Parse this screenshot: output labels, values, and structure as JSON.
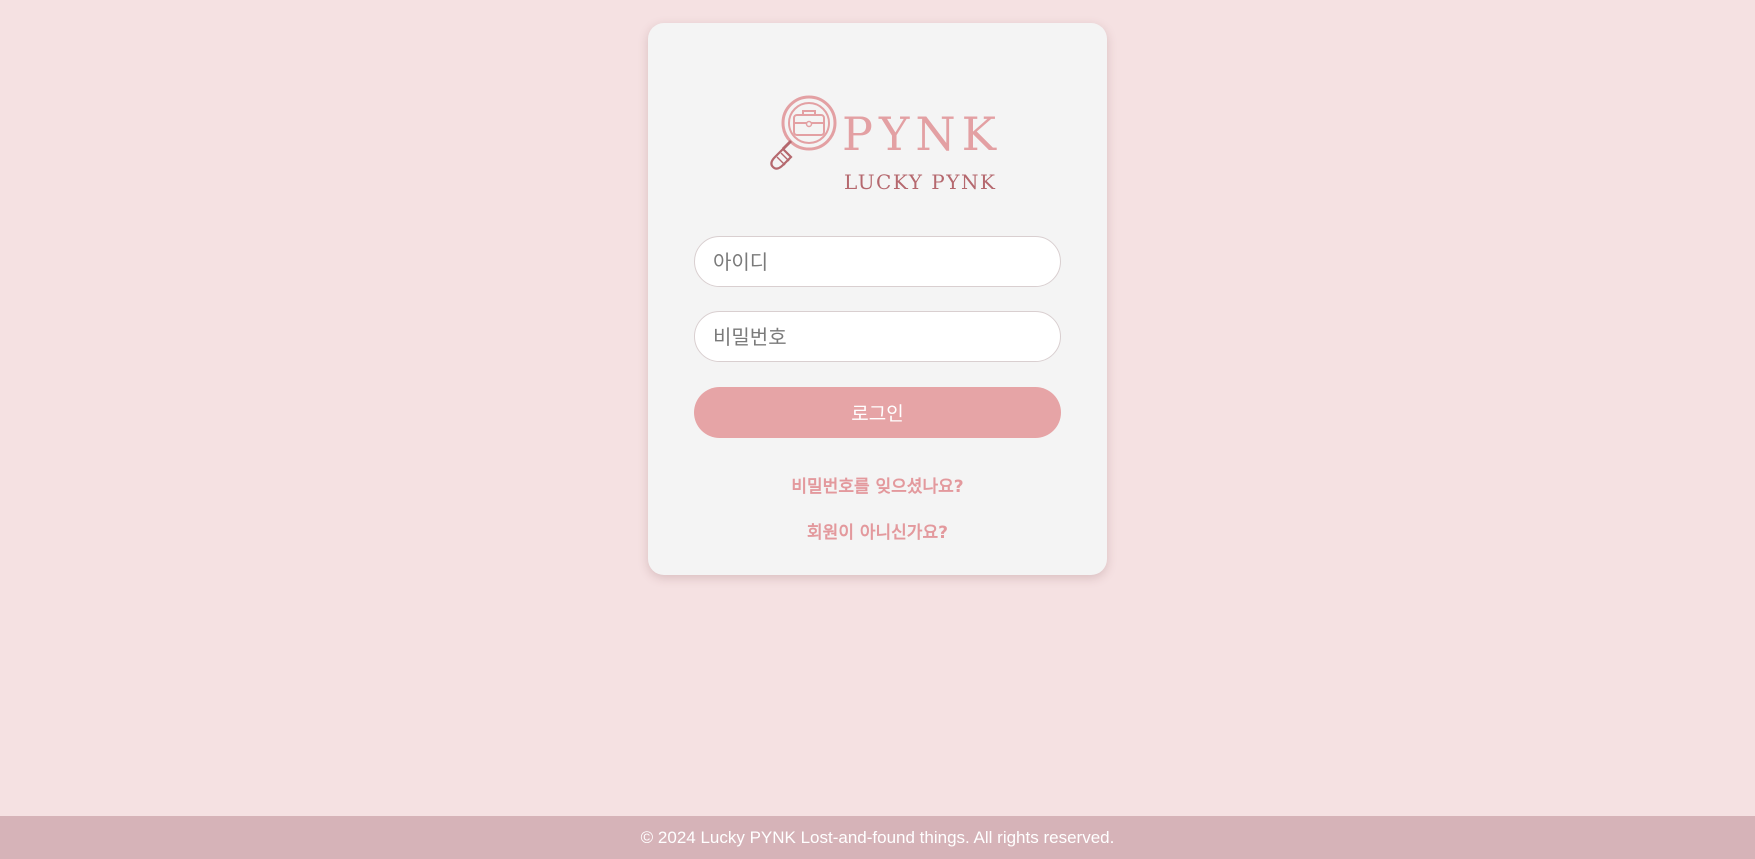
{
  "brand": {
    "main": "PYNK",
    "sub": "LUCKY PYNK",
    "icon": "magnifier-briefcase-icon",
    "colors": {
      "light": "#e3a0a3",
      "dark": "#b5686e"
    }
  },
  "login_form": {
    "id_placeholder": "아이디",
    "password_placeholder": "비밀번호",
    "login_label": "로그인",
    "forgot_password": "비밀번호를 잊으셨나요?",
    "signup": "회원이 아니신가요?"
  },
  "colors": {
    "background": "#f5e1e2",
    "card": "#f4f4f4",
    "button": "#e6a4a6",
    "link": "#e3999d",
    "footer": "#d6b3b8"
  },
  "footer": {
    "text": "© 2024 Lucky PYNK Lost-and-found things. All rights reserved."
  }
}
